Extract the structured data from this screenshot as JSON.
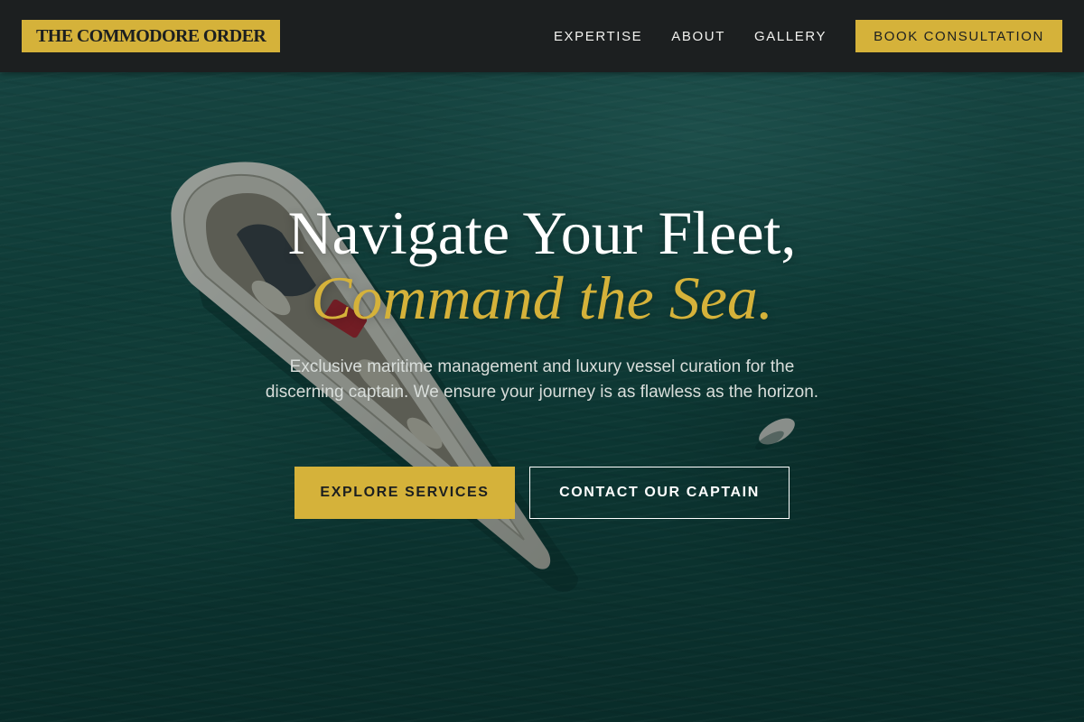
{
  "brand": {
    "name": "THE COMMODORE ORDER",
    "accent_color": "#d5b23a",
    "dark_color": "#1c1f20"
  },
  "nav": {
    "links": [
      {
        "label": "EXPERTISE"
      },
      {
        "label": "ABOUT"
      },
      {
        "label": "GALLERY"
      }
    ],
    "cta_label": "BOOK CONSULTATION"
  },
  "hero": {
    "headline_line1": "Navigate Your Fleet,",
    "headline_line2": "Command the Sea.",
    "subtitle": "Exclusive maritime management and luxury vessel curation for the discerning captain. We ensure your journey is as flawless as the horizon.",
    "primary_cta": "EXPLORE SERVICES",
    "secondary_cta": "CONTACT OUR CAPTAIN",
    "background_image": "aerial-yacht-on-teal-sea"
  }
}
